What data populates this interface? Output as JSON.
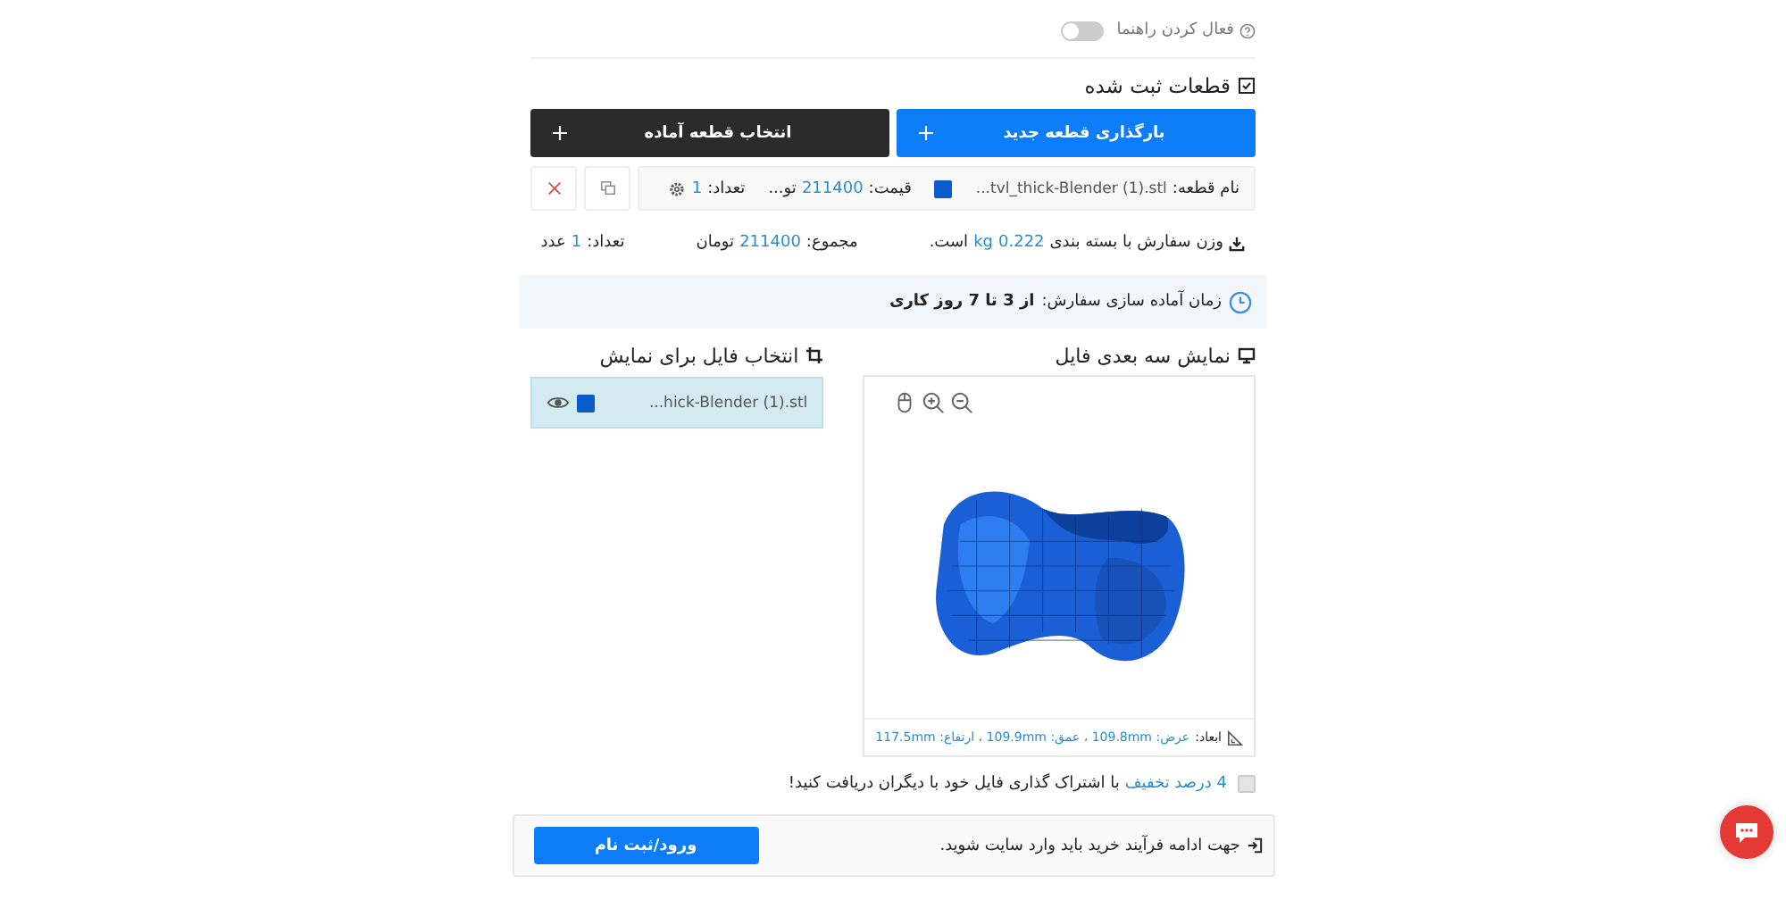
{
  "guide_toggle": {
    "label": "فعال کردن راهنما",
    "on": false
  },
  "registered_parts": {
    "title": "قطعات ثبت شده",
    "upload_button": "بارگذاری قطعه جدید",
    "ready_button": "انتخاب قطعه آماده",
    "parts": [
      {
        "name_label": "نام قطعه:",
        "name": "...tvl_thick-Blender (1).stl",
        "color": "#0a5ccc",
        "price_label": "قیمت:",
        "price": "211400",
        "price_unit": "تو...",
        "count_label": "تعداد:",
        "count": "1"
      }
    ]
  },
  "summary": {
    "weight_before": "وزن سفارش با بسته بندی",
    "weight": "0.222",
    "weight_unit": "kg",
    "weight_after": "است.",
    "total_label": "مجموع:",
    "total": "211400",
    "total_unit": "تومان",
    "count_label": "تعداد:",
    "count": "1",
    "count_unit": "عدد"
  },
  "prep_time": {
    "label": "زمان آماده سازی سفارش:",
    "value": "از 3 تا 7 روز کاری"
  },
  "viewer": {
    "title": "نمایش سه بعدی فایل",
    "dims_label": "ابعاد:",
    "dims": "عرض: 109.8mm ، عمق: 109.9mm ، ارتفاع: 117.5mm"
  },
  "file_select": {
    "title": "انتخاب فایل برای نمایش",
    "files": [
      {
        "name": "...hick-Blender (1).stl",
        "color": "#0a5ccc",
        "selected": true
      }
    ]
  },
  "discount": {
    "checked": false,
    "link": "4 درصد تخفیف",
    "text": "با اشتراک گذاری فایل خود با دیگران دریافت کنید!"
  },
  "login_notice": {
    "text": "جهت ادامه فرآیند خرید باید وارد سایت شوید.",
    "button": "ورود/ثبت نام"
  }
}
